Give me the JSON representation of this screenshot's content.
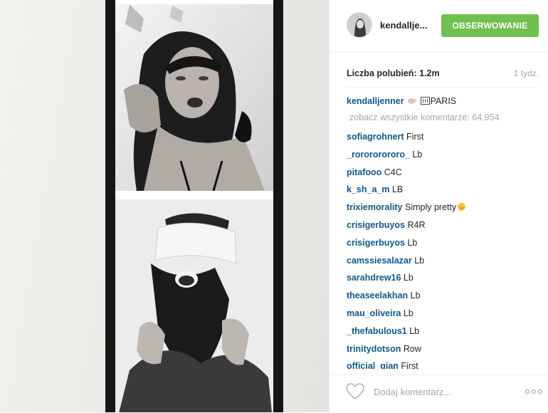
{
  "post": {
    "username": "kendallje...",
    "follow_label": "OBSERWOWANIE",
    "likes_label": "Liczba polubień:",
    "likes_value": "1.2m",
    "time_ago": "1 tydz."
  },
  "caption": {
    "user": "kendalljenner",
    "text": "PARIS",
    "wave_icon": "waving-hand-emoji",
    "flag_icon": "france-flag-emoji"
  },
  "view_all_comments": "zobacz wszystkie komentarze: 64,954",
  "comments": [
    {
      "user": "sofiagrohnert",
      "text": "First"
    },
    {
      "user": "_rorororororo_",
      "text": "Lb"
    },
    {
      "user": "pitafooo",
      "text": "C4C"
    },
    {
      "user": "k_sh_a_m",
      "text": "LB"
    },
    {
      "user": "trixiemorality",
      "text": "Simply pretty"
    },
    {
      "user": "crisigerbuyos",
      "text": "R4R"
    },
    {
      "user": "crisigerbuyos",
      "text": "Lb"
    },
    {
      "user": "camssiesalazar",
      "text": "Lb"
    },
    {
      "user": "sarahdrew16",
      "text": "Lb"
    },
    {
      "user": "theaseelakhan",
      "text": "Lb"
    },
    {
      "user": "mau_oliveira",
      "text": "Lb"
    },
    {
      "user": "_thefabulous1",
      "text": "Lb"
    },
    {
      "user": "trinitydotson",
      "text": "Row"
    },
    {
      "user": "official_gian",
      "text": "First"
    }
  ],
  "add_comment_placeholder": "Dodaj komentarz...",
  "colors": {
    "follow_button": "#70c050",
    "username_link": "#125688",
    "muted_text": "#a5a7aa"
  }
}
